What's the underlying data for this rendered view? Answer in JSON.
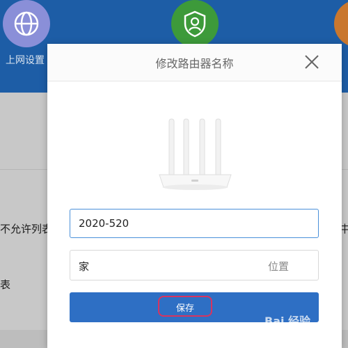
{
  "background": {
    "top_nav": {
      "items": [
        {
          "label": "上网设置",
          "icon": "globe-icon",
          "color": "#8a8fd8"
        },
        {
          "label": "",
          "icon": "shield-user-icon",
          "color": "#3d9a3a"
        },
        {
          "label": "",
          "icon": "circle-icon",
          "color": "#c9772e"
        }
      ]
    },
    "list_text_1": "不允许列表",
    "list_text_2": "表",
    "list_text_right": "中"
  },
  "modal": {
    "title": "修改路由器名称",
    "close_icon": "close-icon",
    "router_image_icon": "router-icon",
    "name_input_value": "2020-520",
    "location_value": "家",
    "location_label": "位置",
    "save_label": "保存",
    "colors": {
      "accent": "#2e6fc4",
      "input_border": "#4a90d9",
      "highlight": "#d8345f"
    }
  },
  "watermark": "Bai 经验"
}
